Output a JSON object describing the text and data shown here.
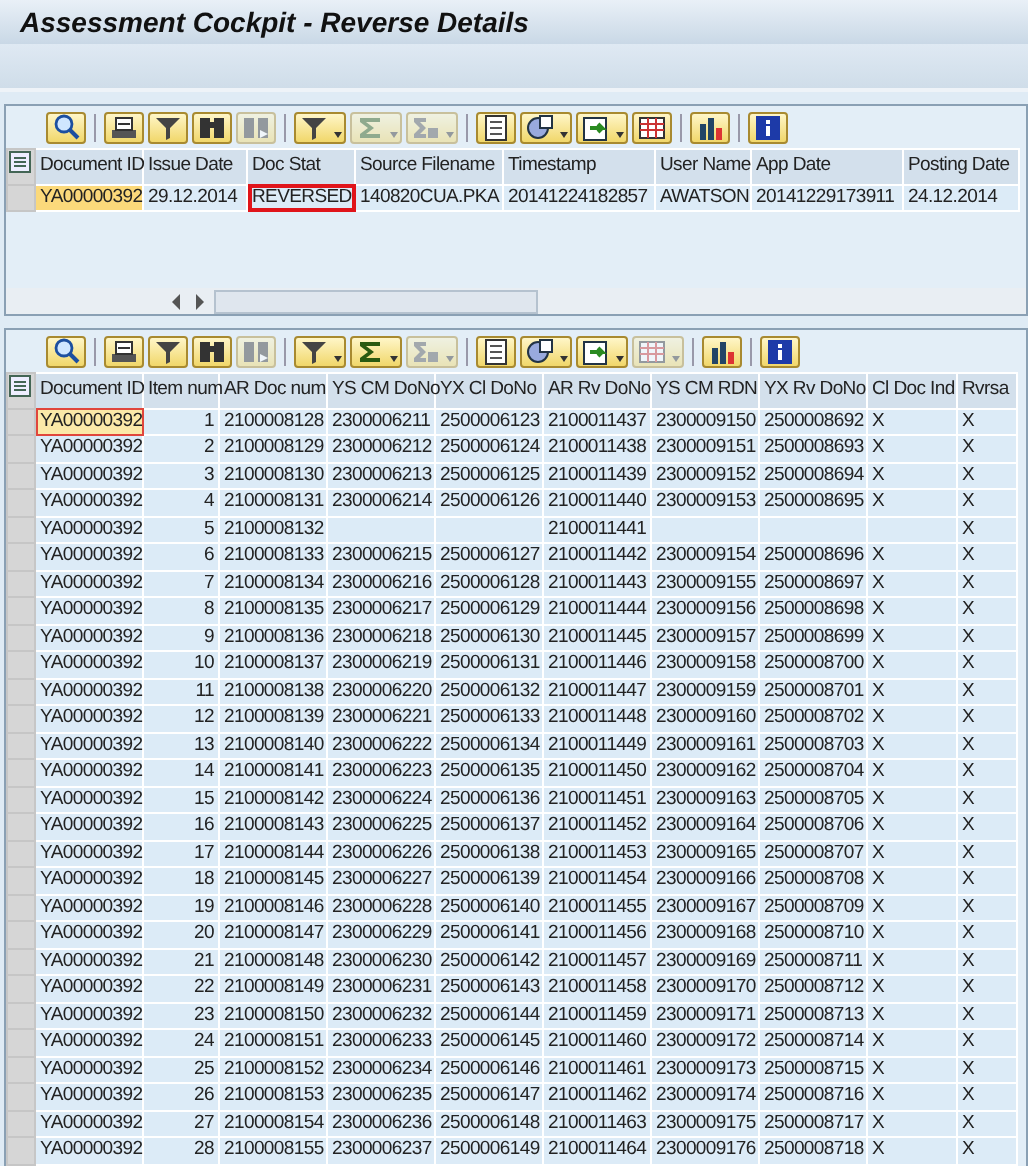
{
  "window": {
    "title": "Assessment Cockpit - Reverse Details"
  },
  "header_table": {
    "toolbar": [
      {
        "kind": "details",
        "disabled": false,
        "dropdown": false
      },
      {
        "kind": "print",
        "disabled": false,
        "dropdown": false
      },
      {
        "kind": "filter",
        "disabled": false,
        "dropdown": false
      },
      {
        "kind": "find",
        "disabled": false,
        "dropdown": false
      },
      {
        "kind": "findnext",
        "disabled": true,
        "dropdown": false
      },
      {
        "kind": "filter",
        "disabled": false,
        "dropdown": true
      },
      {
        "kind": "sum",
        "disabled": true,
        "dropdown": true
      },
      {
        "kind": "subtotal",
        "disabled": true,
        "dropdown": true
      },
      {
        "kind": "preview",
        "disabled": false,
        "dropdown": false
      },
      {
        "kind": "views",
        "disabled": false,
        "dropdown": true
      },
      {
        "kind": "export",
        "disabled": false,
        "dropdown": true
      },
      {
        "kind": "grid",
        "disabled": false,
        "dropdown": false
      },
      {
        "kind": "chart",
        "disabled": false,
        "dropdown": false
      },
      {
        "kind": "info",
        "disabled": false,
        "dropdown": false
      }
    ],
    "columns": [
      "Document ID",
      "Issue Date",
      "Doc Stat",
      "Source Filename",
      "Timestamp",
      "User Name",
      "App Date",
      "Posting Date"
    ],
    "rows": [
      {
        "cells": [
          {
            "text": "YA00000392",
            "focused": true,
            "annotated": false
          },
          {
            "text": "29.12.2014",
            "focused": false,
            "annotated": false
          },
          {
            "text": "REVERSED",
            "focused": false,
            "annotated": true
          },
          {
            "text": "140820CUA.PKA",
            "focused": false,
            "annotated": false
          },
          {
            "text": "20141224182857",
            "focused": false,
            "annotated": false
          },
          {
            "text": "AWATSON",
            "focused": false,
            "annotated": false
          },
          {
            "text": "20141229173911",
            "focused": false,
            "annotated": false
          },
          {
            "text": "24.12.2014",
            "focused": false,
            "annotated": false
          }
        ]
      }
    ]
  },
  "items_table": {
    "toolbar": [
      {
        "kind": "details",
        "disabled": false,
        "dropdown": false
      },
      {
        "kind": "print",
        "disabled": false,
        "dropdown": false
      },
      {
        "kind": "filter",
        "disabled": false,
        "dropdown": false
      },
      {
        "kind": "find",
        "disabled": false,
        "dropdown": false
      },
      {
        "kind": "findnext",
        "disabled": true,
        "dropdown": false
      },
      {
        "kind": "filter",
        "disabled": false,
        "dropdown": true
      },
      {
        "kind": "sum",
        "disabled": false,
        "dropdown": true
      },
      {
        "kind": "subtotal",
        "disabled": true,
        "dropdown": true
      },
      {
        "kind": "preview",
        "disabled": false,
        "dropdown": false
      },
      {
        "kind": "views",
        "disabled": false,
        "dropdown": true
      },
      {
        "kind": "export",
        "disabled": false,
        "dropdown": true
      },
      {
        "kind": "grid",
        "disabled": true,
        "dropdown": true
      },
      {
        "kind": "chart",
        "disabled": false,
        "dropdown": false
      },
      {
        "kind": "info",
        "disabled": false,
        "dropdown": false
      }
    ],
    "columns": [
      "Document ID",
      "Item num",
      "AR Doc num",
      "YS CM DoNo",
      "YX Cl DoNo",
      "AR Rv DoNo",
      "YS CM RDN",
      "YX Rv DoNo",
      "Cl Doc Ind",
      "Rvrsa"
    ],
    "rows": [
      {
        "focused": true,
        "cells": [
          "YA00000392",
          "1",
          "2100008128",
          "2300006211",
          "2500006123",
          "2100011437",
          "2300009150",
          "2500008692",
          "X",
          "X"
        ]
      },
      {
        "focused": false,
        "cells": [
          "YA00000392",
          "2",
          "2100008129",
          "2300006212",
          "2500006124",
          "2100011438",
          "2300009151",
          "2500008693",
          "X",
          "X"
        ]
      },
      {
        "focused": false,
        "cells": [
          "YA00000392",
          "3",
          "2100008130",
          "2300006213",
          "2500006125",
          "2100011439",
          "2300009152",
          "2500008694",
          "X",
          "X"
        ]
      },
      {
        "focused": false,
        "cells": [
          "YA00000392",
          "4",
          "2100008131",
          "2300006214",
          "2500006126",
          "2100011440",
          "2300009153",
          "2500008695",
          "X",
          "X"
        ]
      },
      {
        "focused": false,
        "cells": [
          "YA00000392",
          "5",
          "2100008132",
          "",
          "",
          "2100011441",
          "",
          "",
          "",
          "X"
        ]
      },
      {
        "focused": false,
        "cells": [
          "YA00000392",
          "6",
          "2100008133",
          "2300006215",
          "2500006127",
          "2100011442",
          "2300009154",
          "2500008696",
          "X",
          "X"
        ]
      },
      {
        "focused": false,
        "cells": [
          "YA00000392",
          "7",
          "2100008134",
          "2300006216",
          "2500006128",
          "2100011443",
          "2300009155",
          "2500008697",
          "X",
          "X"
        ]
      },
      {
        "focused": false,
        "cells": [
          "YA00000392",
          "8",
          "2100008135",
          "2300006217",
          "2500006129",
          "2100011444",
          "2300009156",
          "2500008698",
          "X",
          "X"
        ]
      },
      {
        "focused": false,
        "cells": [
          "YA00000392",
          "9",
          "2100008136",
          "2300006218",
          "2500006130",
          "2100011445",
          "2300009157",
          "2500008699",
          "X",
          "X"
        ]
      },
      {
        "focused": false,
        "cells": [
          "YA00000392",
          "10",
          "2100008137",
          "2300006219",
          "2500006131",
          "2100011446",
          "2300009158",
          "2500008700",
          "X",
          "X"
        ]
      },
      {
        "focused": false,
        "cells": [
          "YA00000392",
          "11",
          "2100008138",
          "2300006220",
          "2500006132",
          "2100011447",
          "2300009159",
          "2500008701",
          "X",
          "X"
        ]
      },
      {
        "focused": false,
        "cells": [
          "YA00000392",
          "12",
          "2100008139",
          "2300006221",
          "2500006133",
          "2100011448",
          "2300009160",
          "2500008702",
          "X",
          "X"
        ]
      },
      {
        "focused": false,
        "cells": [
          "YA00000392",
          "13",
          "2100008140",
          "2300006222",
          "2500006134",
          "2100011449",
          "2300009161",
          "2500008703",
          "X",
          "X"
        ]
      },
      {
        "focused": false,
        "cells": [
          "YA00000392",
          "14",
          "2100008141",
          "2300006223",
          "2500006135",
          "2100011450",
          "2300009162",
          "2500008704",
          "X",
          "X"
        ]
      },
      {
        "focused": false,
        "cells": [
          "YA00000392",
          "15",
          "2100008142",
          "2300006224",
          "2500006136",
          "2100011451",
          "2300009163",
          "2500008705",
          "X",
          "X"
        ]
      },
      {
        "focused": false,
        "cells": [
          "YA00000392",
          "16",
          "2100008143",
          "2300006225",
          "2500006137",
          "2100011452",
          "2300009164",
          "2500008706",
          "X",
          "X"
        ]
      },
      {
        "focused": false,
        "cells": [
          "YA00000392",
          "17",
          "2100008144",
          "2300006226",
          "2500006138",
          "2100011453",
          "2300009165",
          "2500008707",
          "X",
          "X"
        ]
      },
      {
        "focused": false,
        "cells": [
          "YA00000392",
          "18",
          "2100008145",
          "2300006227",
          "2500006139",
          "2100011454",
          "2300009166",
          "2500008708",
          "X",
          "X"
        ]
      },
      {
        "focused": false,
        "cells": [
          "YA00000392",
          "19",
          "2100008146",
          "2300006228",
          "2500006140",
          "2100011455",
          "2300009167",
          "2500008709",
          "X",
          "X"
        ]
      },
      {
        "focused": false,
        "cells": [
          "YA00000392",
          "20",
          "2100008147",
          "2300006229",
          "2500006141",
          "2100011456",
          "2300009168",
          "2500008710",
          "X",
          "X"
        ]
      },
      {
        "focused": false,
        "cells": [
          "YA00000392",
          "21",
          "2100008148",
          "2300006230",
          "2500006142",
          "2100011457",
          "2300009169",
          "2500008711",
          "X",
          "X"
        ]
      },
      {
        "focused": false,
        "cells": [
          "YA00000392",
          "22",
          "2100008149",
          "2300006231",
          "2500006143",
          "2100011458",
          "2300009170",
          "2500008712",
          "X",
          "X"
        ]
      },
      {
        "focused": false,
        "cells": [
          "YA00000392",
          "23",
          "2100008150",
          "2300006232",
          "2500006144",
          "2100011459",
          "2300009171",
          "2500008713",
          "X",
          "X"
        ]
      },
      {
        "focused": false,
        "cells": [
          "YA00000392",
          "24",
          "2100008151",
          "2300006233",
          "2500006145",
          "2100011460",
          "2300009172",
          "2500008714",
          "X",
          "X"
        ]
      },
      {
        "focused": false,
        "cells": [
          "YA00000392",
          "25",
          "2100008152",
          "2300006234",
          "2500006146",
          "2100011461",
          "2300009173",
          "2500008715",
          "X",
          "X"
        ]
      },
      {
        "focused": false,
        "cells": [
          "YA00000392",
          "26",
          "2100008153",
          "2300006235",
          "2500006147",
          "2100011462",
          "2300009174",
          "2500008716",
          "X",
          "X"
        ]
      },
      {
        "focused": false,
        "cells": [
          "YA00000392",
          "27",
          "2100008154",
          "2300006236",
          "2500006148",
          "2100011463",
          "2300009175",
          "2500008717",
          "X",
          "X"
        ]
      },
      {
        "focused": false,
        "cells": [
          "YA00000392",
          "28",
          "2100008155",
          "2300006237",
          "2500006149",
          "2100011464",
          "2300009176",
          "2500008718",
          "X",
          "X"
        ]
      }
    ]
  }
}
